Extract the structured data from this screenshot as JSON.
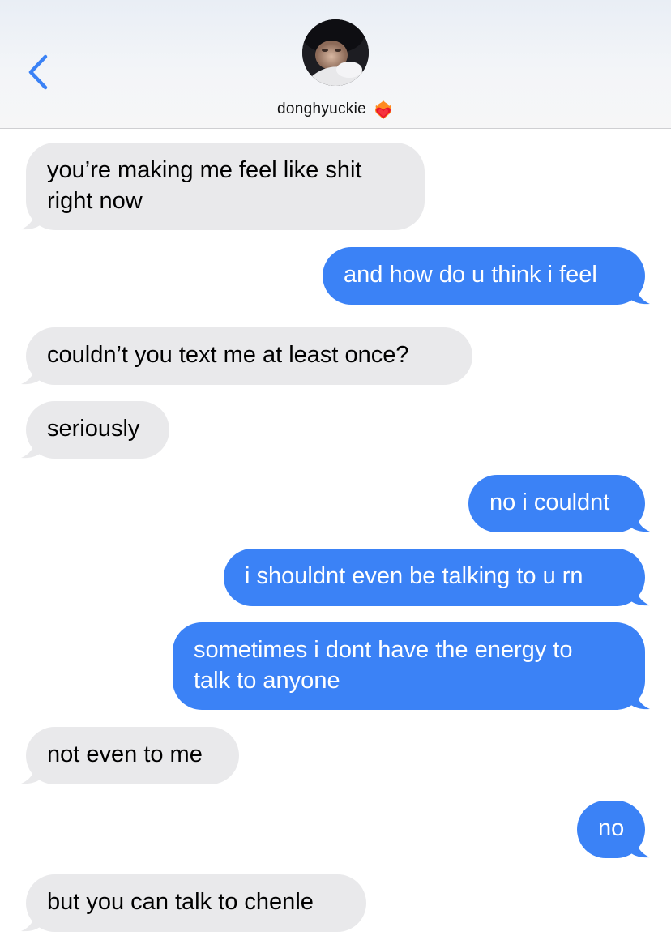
{
  "header": {
    "back_icon": "chevron-left-icon",
    "avatar_icon": "contact-photo",
    "contact_name": "donghyuckie",
    "status_emoji_icon": "heart-on-fire-icon"
  },
  "colors": {
    "accent": "#3b82f6",
    "received_bubble": "#e9e9eb",
    "sent_text": "#ffffff",
    "received_text": "#000000"
  },
  "messages": [
    {
      "direction": "received",
      "text": "you’re making me feel like shit\nright now"
    },
    {
      "direction": "sent",
      "text": "and how do u think i feel"
    },
    {
      "direction": "received",
      "text": "couldn’t you text me at least once?"
    },
    {
      "direction": "received",
      "text": "seriously"
    },
    {
      "direction": "sent",
      "text": "no i couldnt"
    },
    {
      "direction": "sent",
      "text": "i shouldnt even be talking to u rn"
    },
    {
      "direction": "sent",
      "text": "sometimes i dont have the energy to\ntalk to anyone"
    },
    {
      "direction": "received",
      "text": "not even to me"
    },
    {
      "direction": "sent",
      "text": "no"
    },
    {
      "direction": "received",
      "text": "but you can talk to chenle"
    }
  ]
}
